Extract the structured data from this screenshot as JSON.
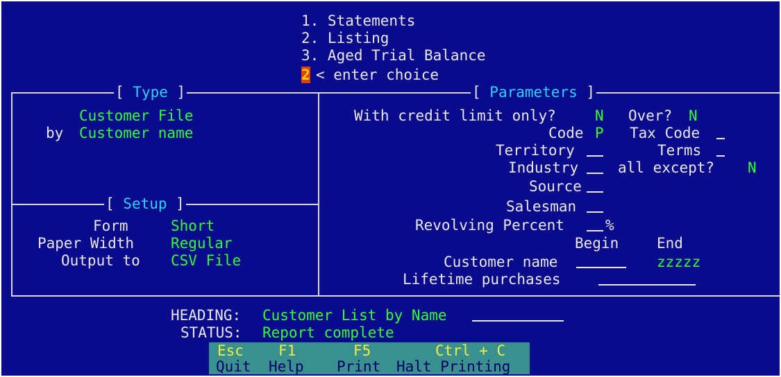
{
  "menu": {
    "items": [
      "1. Statements",
      "2. Listing",
      "3. Aged Trial Balance"
    ],
    "choice_value": "2",
    "prompt": "< enter choice"
  },
  "type_panel": {
    "title": "Type",
    "line1": "Customer File",
    "line2_prefix": "by",
    "line2_value": "Customer name"
  },
  "setup_panel": {
    "title": "Setup",
    "form_label": "Form",
    "form_value": "Short",
    "paper_label": "Paper Width",
    "paper_value": "Regular",
    "output_label": "Output to",
    "output_value": "CSV File"
  },
  "parameters_panel": {
    "title": "Parameters",
    "credit_label": "With credit limit only?",
    "credit_value": "N",
    "over_label": "Over?",
    "over_value": "N",
    "code_label": "Code",
    "code_value": "P",
    "tax_label": "Tax Code",
    "territory_label": "Territory",
    "terms_label": "Terms",
    "industry_label": "Industry",
    "except_label": "all except?",
    "except_value": "N",
    "source_label": "Source",
    "salesman_label": "Salesman",
    "revolving_label": "Revolving Percent",
    "revolving_suffix": "%",
    "begin_label": "Begin",
    "end_label": "End",
    "customer_name_label": "Customer name",
    "customer_name_end": "zzzzz",
    "lifetime_label": "Lifetime purchases"
  },
  "footer": {
    "heading_label": "HEADING:",
    "heading_value": "Customer List by Name",
    "status_label": "STATUS:",
    "status_value": "Report complete"
  },
  "fkeys": [
    {
      "key": "Esc",
      "label": "Quit"
    },
    {
      "key": "F1",
      "label": "Help"
    },
    {
      "key": "F5",
      "label": "Print"
    },
    {
      "key": "Ctrl + C",
      "label": "Halt Printing"
    }
  ],
  "colors": {
    "background": "#0a0a8c",
    "text": "#e8e8e8",
    "value": "#33ff33",
    "title": "#2ad4ff",
    "fkey_bar": "#3a8f8f"
  }
}
